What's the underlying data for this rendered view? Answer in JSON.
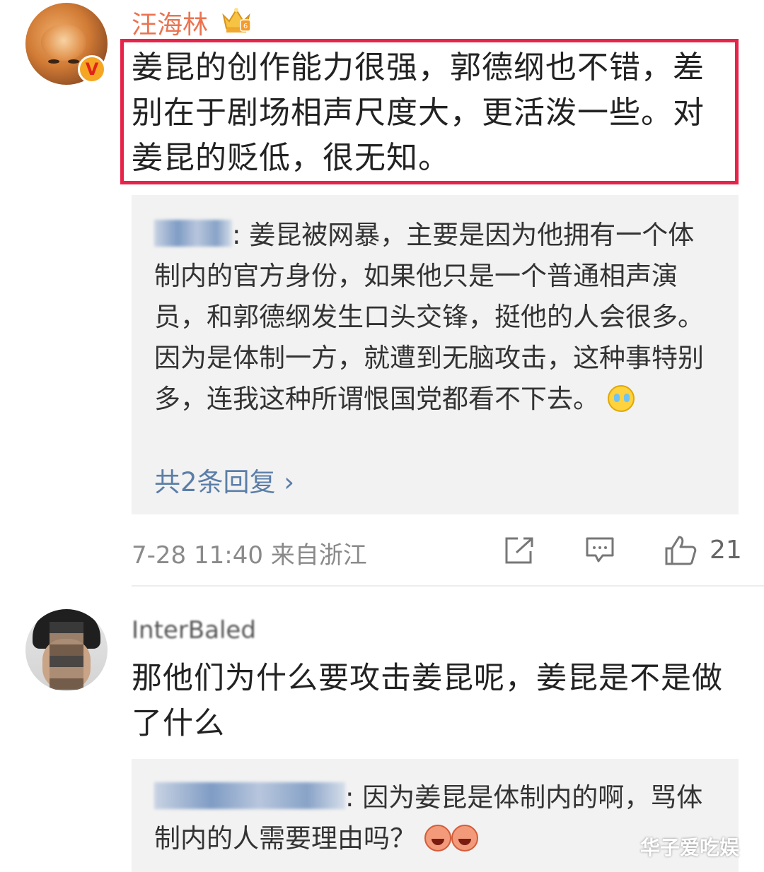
{
  "comment1": {
    "username": "汪海林",
    "text": "姜昆的创作能力很强，郭德纲也不错，差别在于剧场相声尺度大，更活泼一些。对姜昆的贬低，很无知。",
    "reply": {
      "author": "贾晓龙",
      "text": ": 姜昆被网暴，主要是因为他拥有一个体制内的官方身份，如果他只是一个普通相声演员，和郭德纲发生口头交锋，挺他的人会很多。因为是体制一方，就遭到无脑攻击，这种事特别多，连我这种所谓恨国党都看不下去。",
      "emoji": "laugh-cry-emoji",
      "more_label": "共2条回复 ›"
    },
    "timestamp": "7-28 11:40",
    "source": "来自浙江",
    "like_count": "21"
  },
  "comment2": {
    "username": "InterBaled",
    "text": "那他们为什么要攻击姜昆呢，姜昆是不是做了什么",
    "reply": {
      "author": "那个罗平原景狗",
      "text": ": 因为姜昆是体制内的啊，骂体制内的人需要理由吗？",
      "emoji": "grin-emoji"
    }
  },
  "watermark": "华子爱吃娱",
  "colors": {
    "username": "#eb7350",
    "highlight_border": "#e8234a",
    "link": "#5b7ea8",
    "reply_bg": "#f2f2f2",
    "meta": "#8a8a8a"
  }
}
